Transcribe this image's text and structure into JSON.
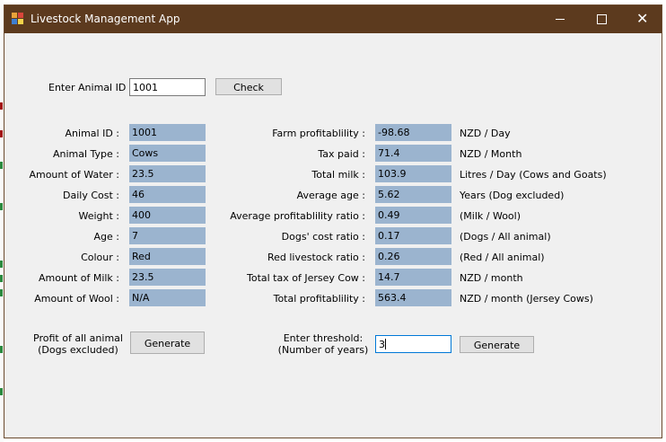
{
  "window": {
    "title": "Livestock Management App"
  },
  "check": {
    "label": "Enter Animal ID :",
    "value": "1001",
    "button": "Check"
  },
  "details": [
    {
      "label": "Animal ID :",
      "value": "1001"
    },
    {
      "label": "Animal Type :",
      "value": "Cows"
    },
    {
      "label": "Amount of Water :",
      "value": "23.5"
    },
    {
      "label": "Daily Cost :",
      "value": "46"
    },
    {
      "label": "Weight :",
      "value": "400"
    },
    {
      "label": "Age :",
      "value": "7"
    },
    {
      "label": "Colour :",
      "value": "Red"
    },
    {
      "label": "Amount of Milk :",
      "value": "23.5"
    },
    {
      "label": "Amount of Wool :",
      "value": "N/A"
    }
  ],
  "stats": [
    {
      "label": "Farm profitablility :",
      "value": "-98.68",
      "unit": "NZD / Day"
    },
    {
      "label": "Tax paid :",
      "value": "71.4",
      "unit": "NZD / Month"
    },
    {
      "label": "Total milk :",
      "value": "103.9",
      "unit": "Litres / Day (Cows and Goats)"
    },
    {
      "label": "Average age :",
      "value": "5.62",
      "unit": "Years (Dog excluded)"
    },
    {
      "label": "Average profitablility ratio :",
      "value": "0.49",
      "unit": "(Milk / Wool)"
    },
    {
      "label": "Dogs' cost ratio :",
      "value": "0.17",
      "unit": "(Dogs / All animal)"
    },
    {
      "label": "Red livestock ratio :",
      "value": "0.26",
      "unit": "(Red / All animal)"
    },
    {
      "label": "Total tax of Jersey Cow :",
      "value": "14.7",
      "unit": "NZD / month"
    },
    {
      "label": "Total profitablility :",
      "value": "563.4",
      "unit": "NZD / month (Jersey Cows)"
    }
  ],
  "profit": {
    "label_line1": "Profit of all animal",
    "label_line2": "(Dogs excluded)",
    "button": "Generate"
  },
  "threshold": {
    "label_line1": "Enter threshold:",
    "label_line2": "(Number of years)",
    "value": "3",
    "button": "Generate"
  },
  "colors": {
    "titlebar": "#5c3a1e",
    "field": "#9bb4cf",
    "window": "#f0f0f0"
  },
  "icons": [
    "app-icon",
    "minimize-icon",
    "maximize-icon",
    "close-icon"
  ]
}
